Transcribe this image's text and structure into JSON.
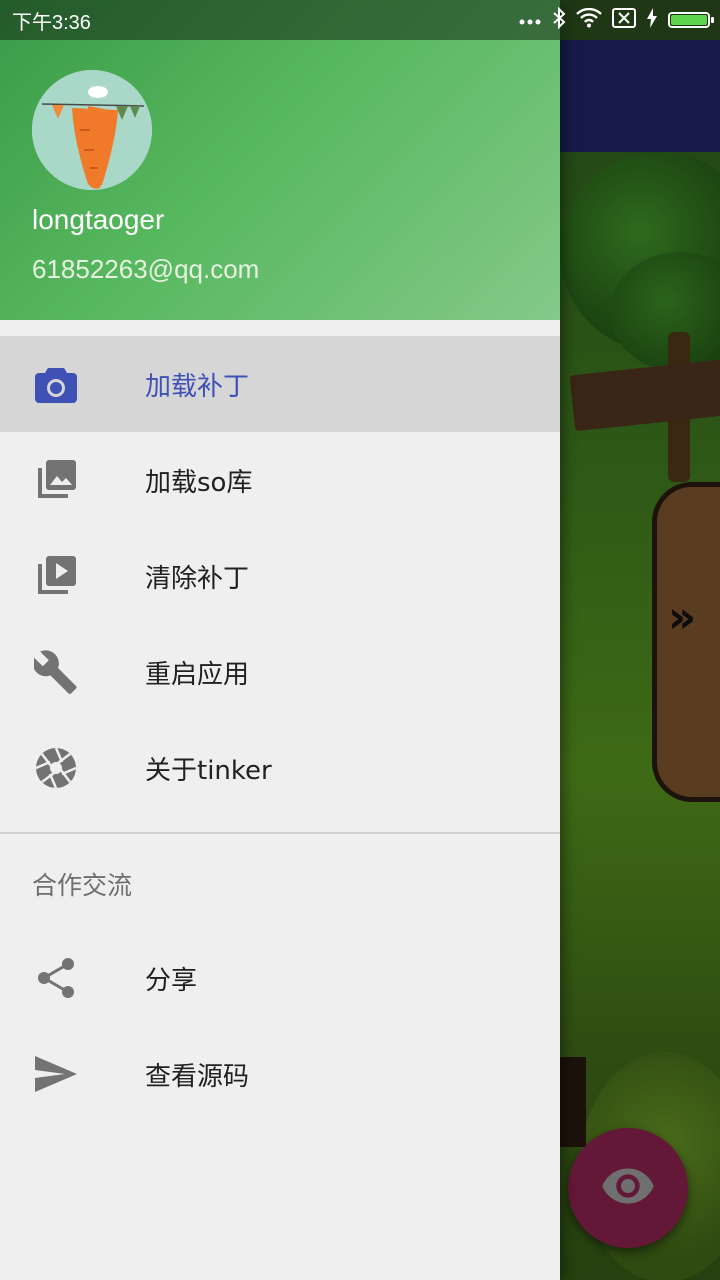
{
  "status_bar": {
    "time": "下午3:36",
    "icons": [
      "more-dots-icon",
      "bluetooth-icon",
      "wifi-icon",
      "sim-off-icon",
      "charging-bolt-icon",
      "battery-icon"
    ],
    "battery_color": "#5dd44e"
  },
  "drawer": {
    "header": {
      "user_name": "longtaoger",
      "user_email": "61852263@qq.com",
      "avatar_icon": "carrot-avatar"
    },
    "menu_items": [
      {
        "label": "加载补丁",
        "icon": "camera-icon",
        "selected": true
      },
      {
        "label": "加载so库",
        "icon": "photo-library-icon",
        "selected": false
      },
      {
        "label": "清除补丁",
        "icon": "video-library-icon",
        "selected": false
      },
      {
        "label": "重启应用",
        "icon": "wrench-icon",
        "selected": false
      },
      {
        "label": "关于tinker",
        "icon": "aperture-icon",
        "selected": false
      }
    ],
    "section_title": "合作交流",
    "section_items": [
      {
        "label": "分享",
        "icon": "share-icon"
      },
      {
        "label": "查看源码",
        "icon": "send-icon"
      }
    ]
  },
  "background": {
    "toolbar_color": "#151a48",
    "fab_icon": "eye-icon",
    "fab_color": "#641838"
  },
  "colors": {
    "accent": "#3f51b5",
    "header_green": "#4caf50",
    "icon_gray": "#737373"
  }
}
